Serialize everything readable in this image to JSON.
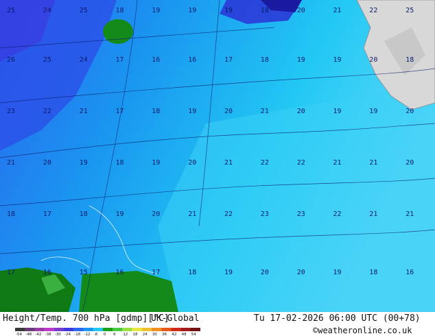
{
  "footer": {
    "title": "Height/Temp. 700 hPa [gdmp][°C]",
    "model": "UK-Global",
    "valid_time": "Tu 17-02-2026 06:00 UTC (00+78)",
    "site": "©weatheronline.co.uk"
  },
  "colorbar": {
    "ticks": [
      "-54",
      "-48",
      "-42",
      "-38",
      "-30",
      "-24",
      "-18",
      "-12",
      "-8",
      "0",
      "6",
      "12",
      "18",
      "24",
      "30",
      "36",
      "42",
      "48",
      "54"
    ],
    "colors": [
      "#3a3a3a",
      "#6a3a7a",
      "#9a3aa8",
      "#c03ac8",
      "#7a3ad0",
      "#3a3ae0",
      "#2a66ee",
      "#1a96f0",
      "#22c8f4",
      "#1aa01a",
      "#4ac840",
      "#9ae040",
      "#e8e840",
      "#f0c030",
      "#f09020",
      "#e85a1a",
      "#d02a1a",
      "#a01a1a",
      "#701010"
    ]
  },
  "field_values": [
    {
      "row": "top",
      "labels": [
        "25",
        "24",
        "25",
        "18",
        "19",
        "19",
        "19",
        "18",
        "20",
        "21",
        "22",
        "25"
      ]
    },
    {
      "row": "upper",
      "labels": [
        "26",
        "25",
        "24",
        "17",
        "16",
        "16",
        "17",
        "18",
        "19",
        "19",
        "20",
        "18"
      ]
    },
    {
      "row": "middle",
      "labels": [
        "23",
        "22",
        "21",
        "17",
        "18",
        "19",
        "20",
        "21",
        "20",
        "19",
        "19",
        "20"
      ]
    },
    {
      "row": "center",
      "labels": [
        "21",
        "20",
        "19",
        "18",
        "19",
        "20",
        "21",
        "22",
        "22",
        "21",
        "21",
        "20"
      ]
    },
    {
      "row": "lower",
      "labels": [
        "18",
        "17",
        "18",
        "19",
        "20",
        "21",
        "22",
        "23",
        "23",
        "22",
        "21",
        "21"
      ]
    },
    {
      "row": "bottom",
      "labels": [
        "17",
        "16",
        "15",
        "16",
        "17",
        "18",
        "19",
        "20",
        "20",
        "19",
        "18",
        "16"
      ]
    }
  ]
}
